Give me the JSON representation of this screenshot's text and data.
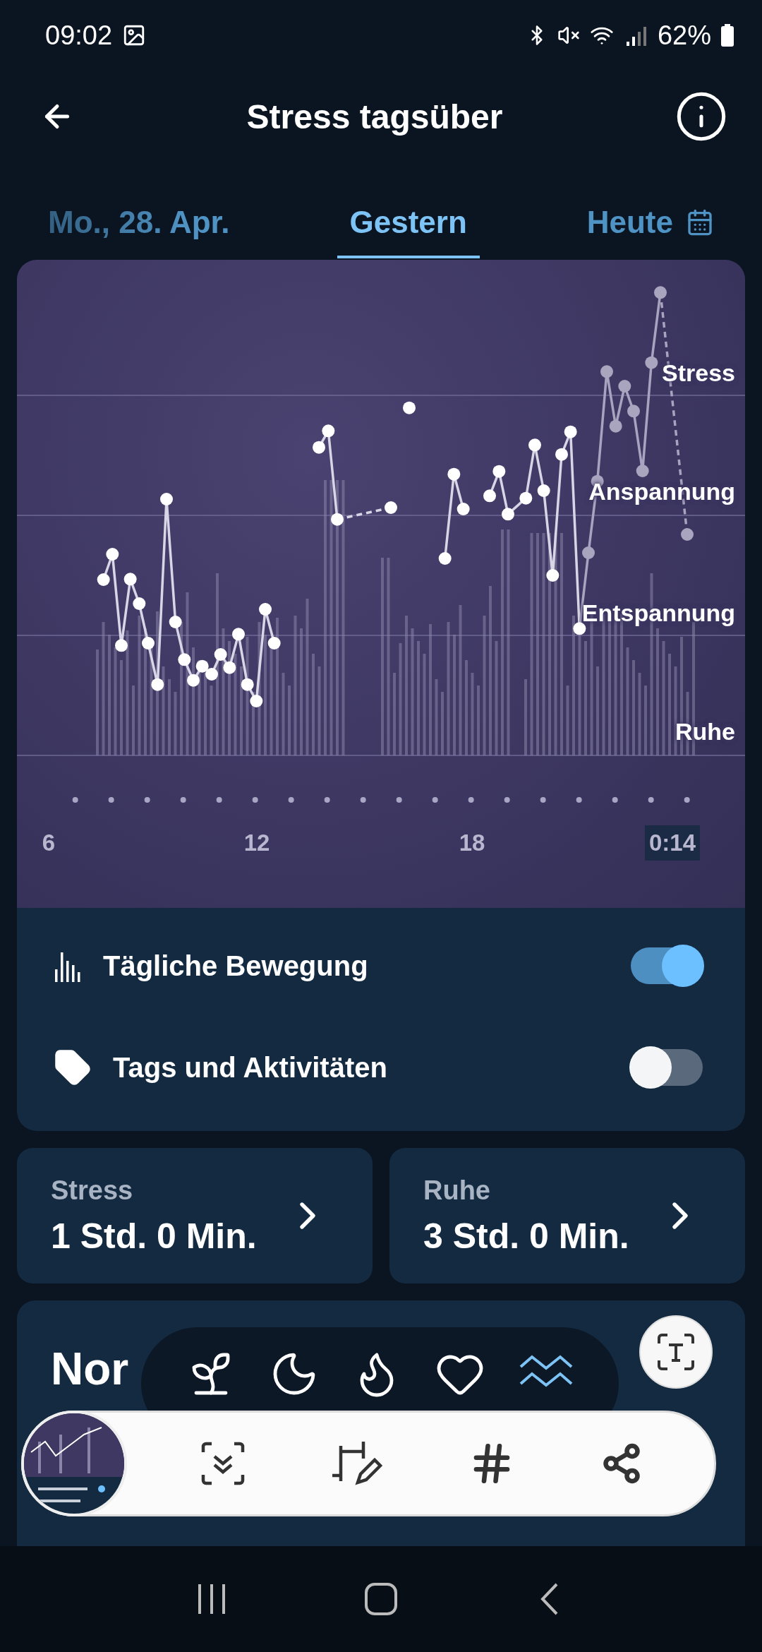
{
  "status_bar": {
    "time": "09:02",
    "battery": "62%"
  },
  "header": {
    "title": "Stress tagsüber"
  },
  "tabs": [
    {
      "label": "Mo., 28. Apr.",
      "selected": false,
      "calendar_icon": false
    },
    {
      "label": "Gestern",
      "selected": true,
      "calendar_icon": false
    },
    {
      "label": "Heute",
      "selected": false,
      "calendar_icon": true
    }
  ],
  "chart": {
    "levels": [
      "Stress",
      "Anspannung",
      "Entspannung",
      "Ruhe"
    ],
    "hours": [
      {
        "label": "6",
        "selected": false
      },
      {
        "label": "12",
        "selected": false
      },
      {
        "label": "18",
        "selected": false
      },
      {
        "label": "0:14",
        "selected": true
      }
    ]
  },
  "toggles": [
    {
      "label": "Tägliche Bewegung",
      "on": true
    },
    {
      "label": "Tags und Aktivitäten",
      "on": false
    }
  ],
  "summary": [
    {
      "label": "Stress",
      "value": "1 Std. 0 Min."
    },
    {
      "label": "Ruhe",
      "value": "3 Std. 0 Min."
    }
  ],
  "day_card": {
    "title": "Nor"
  },
  "bottom_nav": [
    {
      "selected": false
    },
    {
      "selected": false
    },
    {
      "selected": false
    },
    {
      "selected": false
    },
    {
      "selected": true
    }
  ]
}
